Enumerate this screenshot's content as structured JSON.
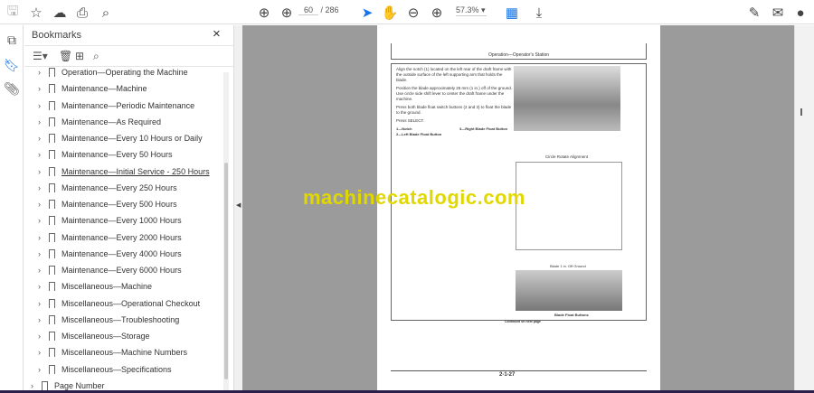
{
  "toolbar": {
    "page_current": "60",
    "page_total": "/ 286",
    "zoom": "57.3%"
  },
  "bookmarks": {
    "title": "Bookmarks",
    "items": [
      "Operation—Operating the Machine",
      "Maintenance—Machine",
      "Maintenance—Periodic Maintenance",
      "Maintenance—As Required",
      "Maintenance—Every 10 Hours or Daily",
      "Maintenance—Every 50 Hours",
      "Maintenance—Initial Service - 250 Hours",
      "Maintenance—Every 250 Hours",
      "Maintenance—Every 500 Hours",
      "Maintenance—Every 1000 Hours",
      "Maintenance—Every 2000 Hours",
      "Maintenance—Every 4000 Hours",
      "Maintenance—Every 6000 Hours",
      "Miscellaneous—Machine",
      "Miscellaneous—Operational Checkout",
      "Miscellaneous—Troubleshooting",
      "Miscellaneous—Storage",
      "Miscellaneous—Machine Numbers",
      "Miscellaneous—Specifications",
      "Page Number"
    ]
  },
  "document": {
    "header": "Operation—Operator's Station",
    "para1": "Align the notch (1) located on the left rear of the draft frame with the outside surface of the left supporting arm that holds the blade.",
    "para2": "Position the blade approximately 25 mm (1 in.) off of the ground. Use circle side shift lever to center the draft frame under the machine.",
    "para3": "Press both blade float switch buttons (2 and 3) to float the blade to the ground.",
    "para4": "Press SELECT.",
    "legend1": "1—Notch",
    "legend2": "2—Left Blade Float Button",
    "legend3": "3—Right Blade Float Button",
    "caption1": "Circle Rotate Alignment",
    "caption2": "Blade 1 in. Off Ground",
    "caption3": "Blade Float Buttons",
    "continued": "Continued on next page",
    "page_number": "2-1-27",
    "watermark": "machinecatalogic.com"
  }
}
